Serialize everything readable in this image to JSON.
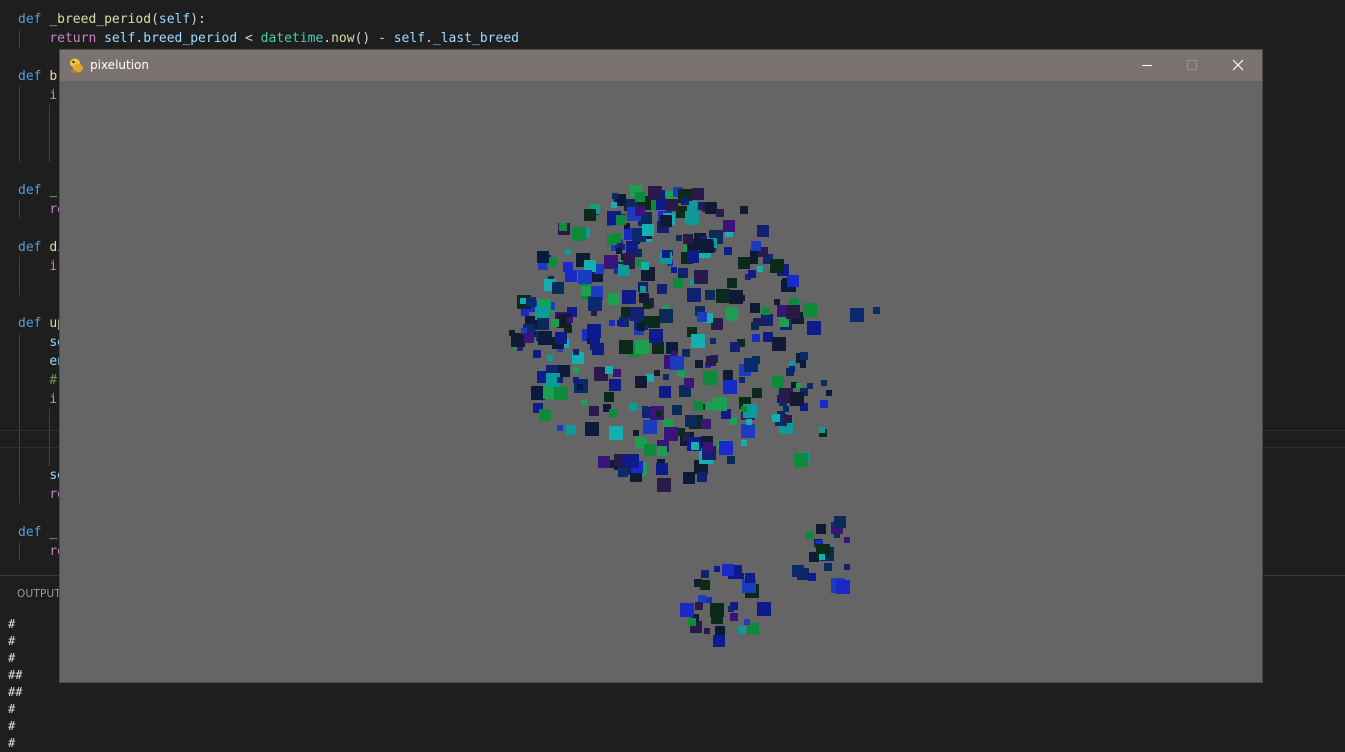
{
  "editor": {
    "code_lines": [
      [
        {
          "t": "def",
          "c": "kw"
        },
        {
          "t": " ",
          "c": "txt"
        },
        {
          "t": "_breed_period",
          "c": "fn"
        },
        {
          "t": "(",
          "c": "txt"
        },
        {
          "t": "self",
          "c": "var"
        },
        {
          "t": "):",
          "c": "txt"
        }
      ],
      [
        {
          "t": "    ",
          "c": "txt"
        },
        {
          "t": "return",
          "c": "ctl"
        },
        {
          "t": " ",
          "c": "txt"
        },
        {
          "t": "self",
          "c": "var"
        },
        {
          "t": ".",
          "c": "txt"
        },
        {
          "t": "breed_period",
          "c": "var"
        },
        {
          "t": " < ",
          "c": "txt"
        },
        {
          "t": "datetime",
          "c": "cls"
        },
        {
          "t": ".",
          "c": "txt"
        },
        {
          "t": "now",
          "c": "fn"
        },
        {
          "t": "() - ",
          "c": "txt"
        },
        {
          "t": "self",
          "c": "var"
        },
        {
          "t": ".",
          "c": "txt"
        },
        {
          "t": "_last_breed",
          "c": "var"
        }
      ],
      [],
      [
        {
          "t": "def",
          "c": "kw"
        },
        {
          "t": " ",
          "c": "txt"
        },
        {
          "t": "br",
          "c": "fn"
        }
      ],
      [
        {
          "t": "    ",
          "c": "txt"
        },
        {
          "t": "i",
          "c": "ctl"
        }
      ],
      [],
      [],
      [],
      [],
      [
        {
          "t": "def",
          "c": "kw"
        },
        {
          "t": " ",
          "c": "txt"
        },
        {
          "t": "_",
          "c": "fn"
        }
      ],
      [
        {
          "t": "    ",
          "c": "txt"
        },
        {
          "t": "re",
          "c": "ctl"
        }
      ],
      [],
      [
        {
          "t": "def",
          "c": "kw"
        },
        {
          "t": " ",
          "c": "txt"
        },
        {
          "t": "di",
          "c": "fn"
        }
      ],
      [
        {
          "t": "    ",
          "c": "txt"
        },
        {
          "t": "i",
          "c": "ctl"
        }
      ],
      [],
      [],
      [
        {
          "t": "def",
          "c": "kw"
        },
        {
          "t": " ",
          "c": "txt"
        },
        {
          "t": "up",
          "c": "fn"
        }
      ],
      [
        {
          "t": "    ",
          "c": "txt"
        },
        {
          "t": "se",
          "c": "var"
        }
      ],
      [
        {
          "t": "    ",
          "c": "txt"
        },
        {
          "t": "en",
          "c": "var"
        }
      ],
      [
        {
          "t": "    ",
          "c": "txt"
        },
        {
          "t": "#",
          "c": "cm"
        }
      ],
      [
        {
          "t": "    ",
          "c": "txt"
        },
        {
          "t": "i",
          "c": "ctl"
        }
      ],
      [],
      [],
      [],
      [
        {
          "t": "    ",
          "c": "txt"
        },
        {
          "t": "se",
          "c": "var"
        }
      ],
      [
        {
          "t": "    ",
          "c": "txt"
        },
        {
          "t": "re",
          "c": "ctl"
        }
      ],
      [],
      [
        {
          "t": "def",
          "c": "kw"
        },
        {
          "t": " ",
          "c": "txt"
        },
        {
          "t": "_",
          "c": "fn"
        }
      ],
      [
        {
          "t": "    ",
          "c": "txt"
        },
        {
          "t": "re",
          "c": "ctl"
        }
      ]
    ]
  },
  "output_panel": {
    "tab_label": "OUTPUT",
    "lines": [
      "#",
      "#",
      "#",
      "##",
      "##",
      "#",
      "#",
      "#"
    ]
  },
  "window": {
    "title": "pixelution",
    "icon": "pygame-snake-icon",
    "controls": [
      "minimize-icon",
      "maximize-icon",
      "close-icon"
    ],
    "titlebar_color": "#7b7371",
    "canvas_color": "#656565"
  },
  "cell_palette": [
    "#0f1a8c",
    "#1a2ac8",
    "#0b2a6e",
    "#122070",
    "#0a1a3a",
    "#0c2a1a",
    "#0d8a3a",
    "#1aa050",
    "#0f9a9a",
    "#14b0b0",
    "#3a1478",
    "#2a1a4a",
    "#101a30",
    "#1c3cc0",
    "#0a2a5a"
  ]
}
